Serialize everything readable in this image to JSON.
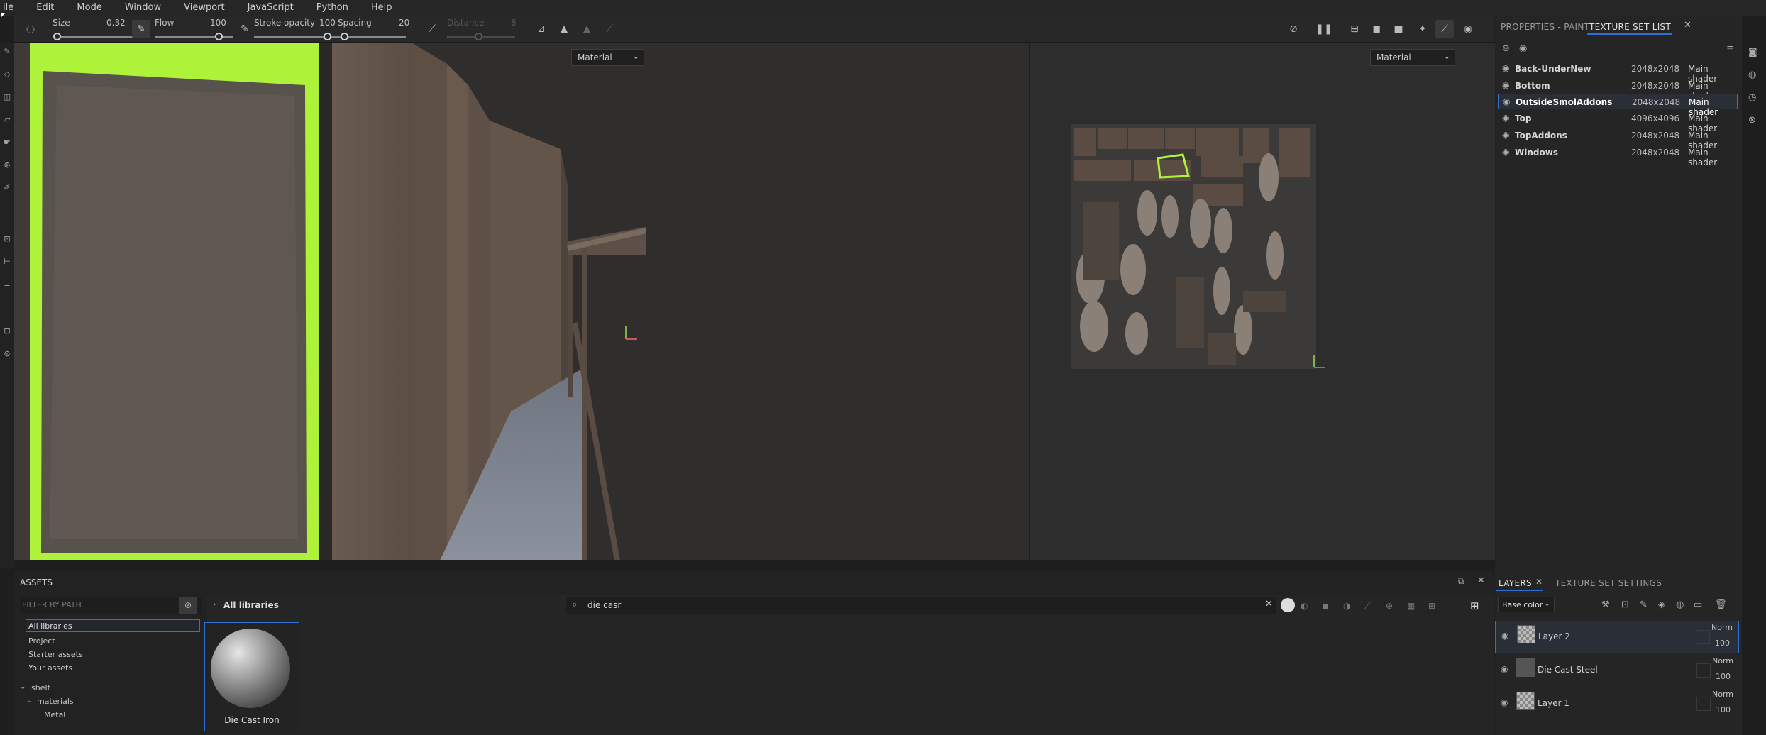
{
  "menu": [
    "ile",
    "Edit",
    "Mode",
    "Window",
    "Viewport",
    "JavaScript",
    "Python",
    "Help"
  ],
  "toolbar": {
    "size_label": "Size",
    "size_value": "0.32",
    "flow_label": "Flow",
    "flow_value": "100",
    "stroke_opacity_label": "Stroke opacity",
    "stroke_opacity_value": "100",
    "spacing_label": "Spacing",
    "spacing_value": "20",
    "distance_label": "Distance",
    "distance_value": "8"
  },
  "viewport": {
    "left_mode": "Material",
    "right_mode": "Material"
  },
  "right_panel": {
    "tab_properties": "PROPERTIES - PAINT",
    "tab_texture_set_list": "TEXTURE SET LIST",
    "texture_sets": [
      {
        "name": "Back-UnderNew",
        "size": "2048x2048",
        "shader": "Main shader"
      },
      {
        "name": "Bottom",
        "size": "2048x2048",
        "shader": "Main shader"
      },
      {
        "name": "OutsideSmolAddons",
        "size": "2048x2048",
        "shader": "Main shader"
      },
      {
        "name": "Top",
        "size": "4096x4096",
        "shader": "Main shader"
      },
      {
        "name": "TopAddons",
        "size": "2048x2048",
        "shader": "Main shader"
      },
      {
        "name": "Windows",
        "size": "2048x2048",
        "shader": "Main shader"
      }
    ],
    "selected_index": 2
  },
  "assets": {
    "title": "ASSETS",
    "filter_placeholder": "FILTER BY PATH",
    "breadcrumb": "All libraries",
    "search_value": "die casr",
    "libraries": [
      "All libraries",
      "Project",
      "Starter assets",
      "Your assets"
    ],
    "tree": [
      "shelf",
      "materials",
      "Metal"
    ],
    "items": [
      {
        "name": "Die Cast Iron"
      }
    ]
  },
  "layers": {
    "tab_layers": "LAYERS",
    "tab_texture_set_settings": "TEXTURE SET SETTINGS",
    "channel": "Base color",
    "items": [
      {
        "name": "Layer 2",
        "blend": "Norm",
        "opacity": "100"
      },
      {
        "name": "Die Cast Steel",
        "blend": "Norm",
        "opacity": "100"
      },
      {
        "name": "Layer 1",
        "blend": "Norm",
        "opacity": "100"
      }
    ]
  },
  "colors": {
    "accent": "#2f6fd6",
    "highlight": "#aef23a"
  }
}
